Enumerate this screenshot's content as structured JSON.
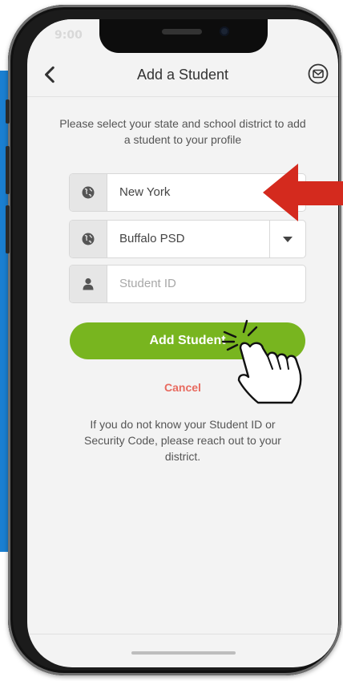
{
  "status_bar": {
    "time": "9:00",
    "icons": ""
  },
  "nav": {
    "title": "Add a Student",
    "back_icon": "chevron-left-icon",
    "mail_icon": "mail-icon"
  },
  "intro": {
    "text": "Please select your state and school district to add a student to your profile"
  },
  "form": {
    "state": {
      "value": "New York",
      "icon": "globe-icon"
    },
    "district": {
      "value": "Buffalo PSD",
      "icon": "globe-icon",
      "dropdown_icon": "caret-down-icon"
    },
    "student_id": {
      "placeholder": "Student ID",
      "icon": "user-icon"
    }
  },
  "actions": {
    "add_label": "Add Student",
    "cancel_label": "Cancel"
  },
  "help": {
    "text": "If you do not know your Student ID or Security Code, please reach out to your district."
  },
  "colors": {
    "accent_green": "#78b51f",
    "cancel_red": "#e86a5f",
    "arrow_red": "#d42a1e",
    "backdrop_blue": "#1a7fd1"
  }
}
